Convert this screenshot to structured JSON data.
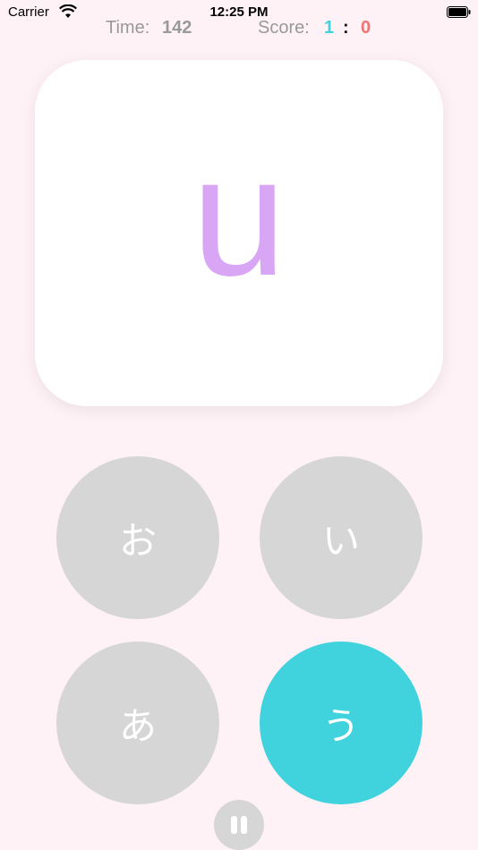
{
  "status_bar": {
    "carrier": "Carrier",
    "time": "12:25 PM",
    "icons": [
      "wifi-icon",
      "battery-icon"
    ]
  },
  "hud": {
    "time_label": "Time:",
    "time_value": "142",
    "score_label": "Score:",
    "score_left": "1",
    "score_separator": ":",
    "score_right": "0"
  },
  "card": {
    "romaji": "u"
  },
  "choices": [
    "お",
    "い",
    "あ",
    "う"
  ],
  "selected_choice": "う",
  "colors": {
    "background": "#fff2f7",
    "romaji": "#d9a6f5",
    "choice_default": "#d6d6d6",
    "choice_selected": "#40d3de",
    "score_left": "#40d3de",
    "score_right": "#f07474"
  },
  "pause_icon": "pause-icon"
}
